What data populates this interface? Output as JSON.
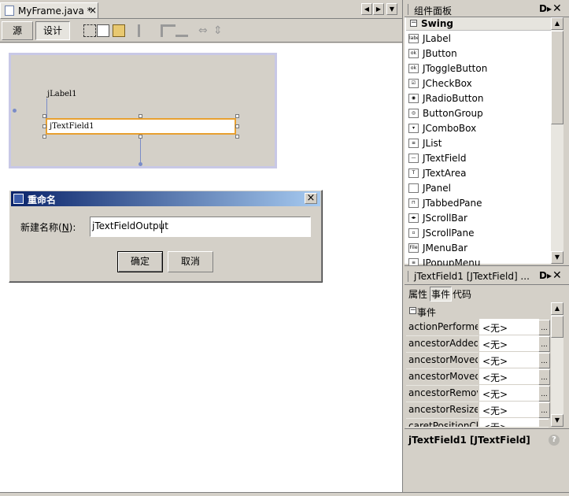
{
  "editor": {
    "tab_title": "MyFrame.java *",
    "close_glyph": "×",
    "source_tab": "源",
    "design_tab": "设计",
    "nav_prev": "◀",
    "nav_next": "▶",
    "nav_menu": "▼"
  },
  "canvas": {
    "label_text": "jLabel1",
    "textfield_text": "jTextField1"
  },
  "dialog": {
    "title": "重命名",
    "close": "×",
    "field_label_pre": "新建名称(",
    "field_label_key": "N",
    "field_label_post": "):",
    "field_value": "jTextFieldOutput",
    "ok_label": "确定",
    "cancel_label": "取消"
  },
  "palette": {
    "title": "组件面板",
    "category": "Swing",
    "expand_glyph": "−",
    "items": [
      {
        "label": "JLabel",
        "icon": "label"
      },
      {
        "label": "JButton",
        "icon": "ok"
      },
      {
        "label": "JToggleButton",
        "icon": "ok"
      },
      {
        "label": "JCheckBox",
        "icon": "☑"
      },
      {
        "label": "JRadioButton",
        "icon": "◉"
      },
      {
        "label": "ButtonGroup",
        "icon": "◎"
      },
      {
        "label": "JComboBox",
        "icon": "▾"
      },
      {
        "label": "JList",
        "icon": "≡"
      },
      {
        "label": "JTextField",
        "icon": "—"
      },
      {
        "label": "JTextArea",
        "icon": "T"
      },
      {
        "label": "JPanel",
        "icon": ""
      },
      {
        "label": "JTabbedPane",
        "icon": "⊓"
      },
      {
        "label": "JScrollBar",
        "icon": "◂▸"
      },
      {
        "label": "JScrollPane",
        "icon": "▫"
      },
      {
        "label": "JMenuBar",
        "icon": "File"
      },
      {
        "label": "JPopupMenu",
        "icon": "≡"
      }
    ]
  },
  "properties": {
    "title": "jTextField1 [JTextField] ...",
    "tabs": [
      "属性",
      "事件",
      "代码"
    ],
    "section": "事件",
    "rows": [
      {
        "name": "actionPerformed",
        "value": "<无>"
      },
      {
        "name": "ancestorAdded",
        "value": "<无>"
      },
      {
        "name": "ancestorMoved",
        "value": "<无>"
      },
      {
        "name": "ancestorMoved",
        "value": "<无>"
      },
      {
        "name": "ancestorRemoved",
        "value": "<无>"
      },
      {
        "name": "ancestorResized",
        "value": "<无>"
      },
      {
        "name": "caretPositionChanged",
        "value": "<无>"
      }
    ],
    "button_glyph": "...",
    "footer": "jTextField1 [JTextField]",
    "help_glyph": "?"
  },
  "colors": {
    "dialog_title_start": "#0a246a",
    "dialog_title_end": "#a6caf0",
    "selection_border": "#e8a030",
    "canvas_border": "#c8c8e6"
  }
}
